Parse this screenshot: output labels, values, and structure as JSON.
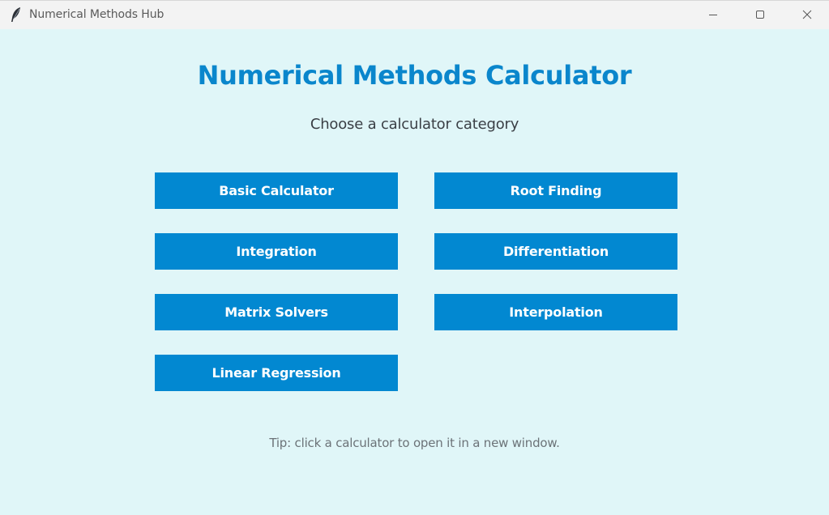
{
  "window": {
    "title": "Numerical Methods Hub",
    "icon": "feather-icon"
  },
  "controls": {
    "minimize": "minimize-icon",
    "maximize": "maximize-icon",
    "close": "close-icon"
  },
  "main": {
    "heading": "Numerical Methods Calculator",
    "subheading": "Choose a calculator category",
    "buttons": [
      "Basic Calculator",
      "Root Finding",
      "Integration",
      "Differentiation",
      "Matrix Solvers",
      "Interpolation",
      "Linear Regression"
    ],
    "tip": "Tip: click a calculator to open it in a new window."
  },
  "colors": {
    "background": "#e0f6f8",
    "accent": "#0288d1",
    "heading": "#0a86cc",
    "titlebar": "#f3f3f3"
  }
}
